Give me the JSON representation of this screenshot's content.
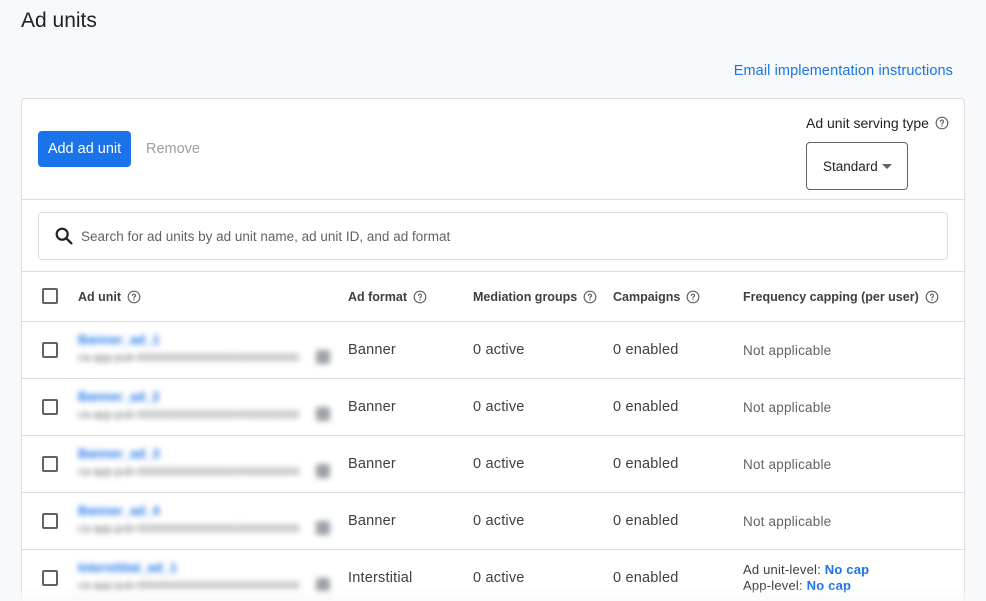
{
  "page": {
    "title": "Ad units",
    "email_link": "Email implementation instructions"
  },
  "toolbar": {
    "add_label": "Add ad unit",
    "remove_label": "Remove",
    "serving_type_label": "Ad unit serving type",
    "serving_type_value": "Standard"
  },
  "search": {
    "placeholder": "Search for ad units by ad unit name, ad unit ID, and ad format"
  },
  "table": {
    "headers": {
      "ad_unit": "Ad unit",
      "ad_format": "Ad format",
      "mediation_groups": "Mediation groups",
      "campaigns": "Campaigns",
      "frequency_capping": "Frequency capping (per user)"
    },
    "rows": [
      {
        "name": "Banner_ad_1",
        "id": "ca-app-pub-0000000000000000/0000000000",
        "format": "Banner",
        "mediation": "0 active",
        "campaigns": "0 enabled",
        "frequency": "Not applicable"
      },
      {
        "name": "Banner_ad_2",
        "id": "ca-app-pub-0000000000000000/0000000000",
        "format": "Banner",
        "mediation": "0 active",
        "campaigns": "0 enabled",
        "frequency": "Not applicable"
      },
      {
        "name": "Banner_ad_3",
        "id": "ca-app-pub-0000000000000000/0000000000",
        "format": "Banner",
        "mediation": "0 active",
        "campaigns": "0 enabled",
        "frequency": "Not applicable"
      },
      {
        "name": "Banner_ad_4",
        "id": "ca-app-pub-0000000000000000/0000000000",
        "format": "Banner",
        "mediation": "0 active",
        "campaigns": "0 enabled",
        "frequency": "Not applicable"
      },
      {
        "name": "Interstitial_ad_1",
        "id": "ca-app-pub-0000000000000000/0000000000",
        "format": "Interstitial",
        "mediation": "0 active",
        "campaigns": "0 enabled",
        "freq_ad_unit_label": "Ad unit-level:",
        "freq_ad_unit_value": "No cap",
        "freq_app_label": "App-level:",
        "freq_app_value": "No cap"
      }
    ]
  },
  "colors": {
    "accent": "#1a73e8",
    "border": "#dadce0",
    "muted": "#9aa0a6"
  },
  "icons": {
    "help": "help-circle-icon",
    "search": "search-icon",
    "dropdown": "caret-down-icon"
  }
}
